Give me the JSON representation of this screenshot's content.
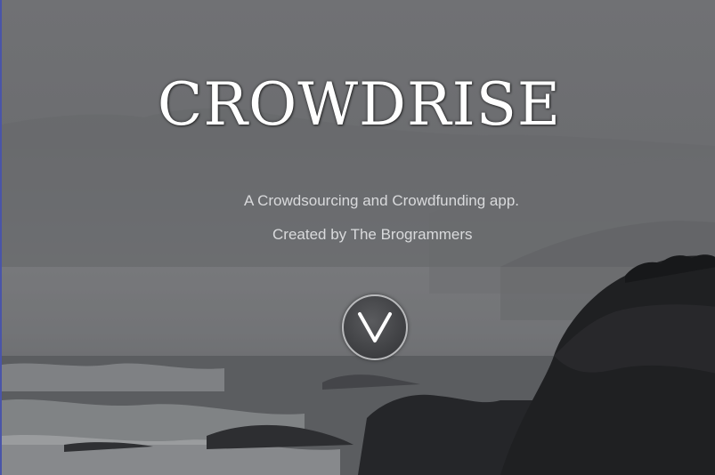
{
  "hero": {
    "title": "CROWDRISE",
    "tagline": "A Crowdsourcing and Crowdfunding app.",
    "credit": "Created by The Brogrammers"
  },
  "scroll_button": {
    "icon": "chevron-down-icon"
  },
  "background": {
    "description_icon": "coastal-landscape-image"
  }
}
